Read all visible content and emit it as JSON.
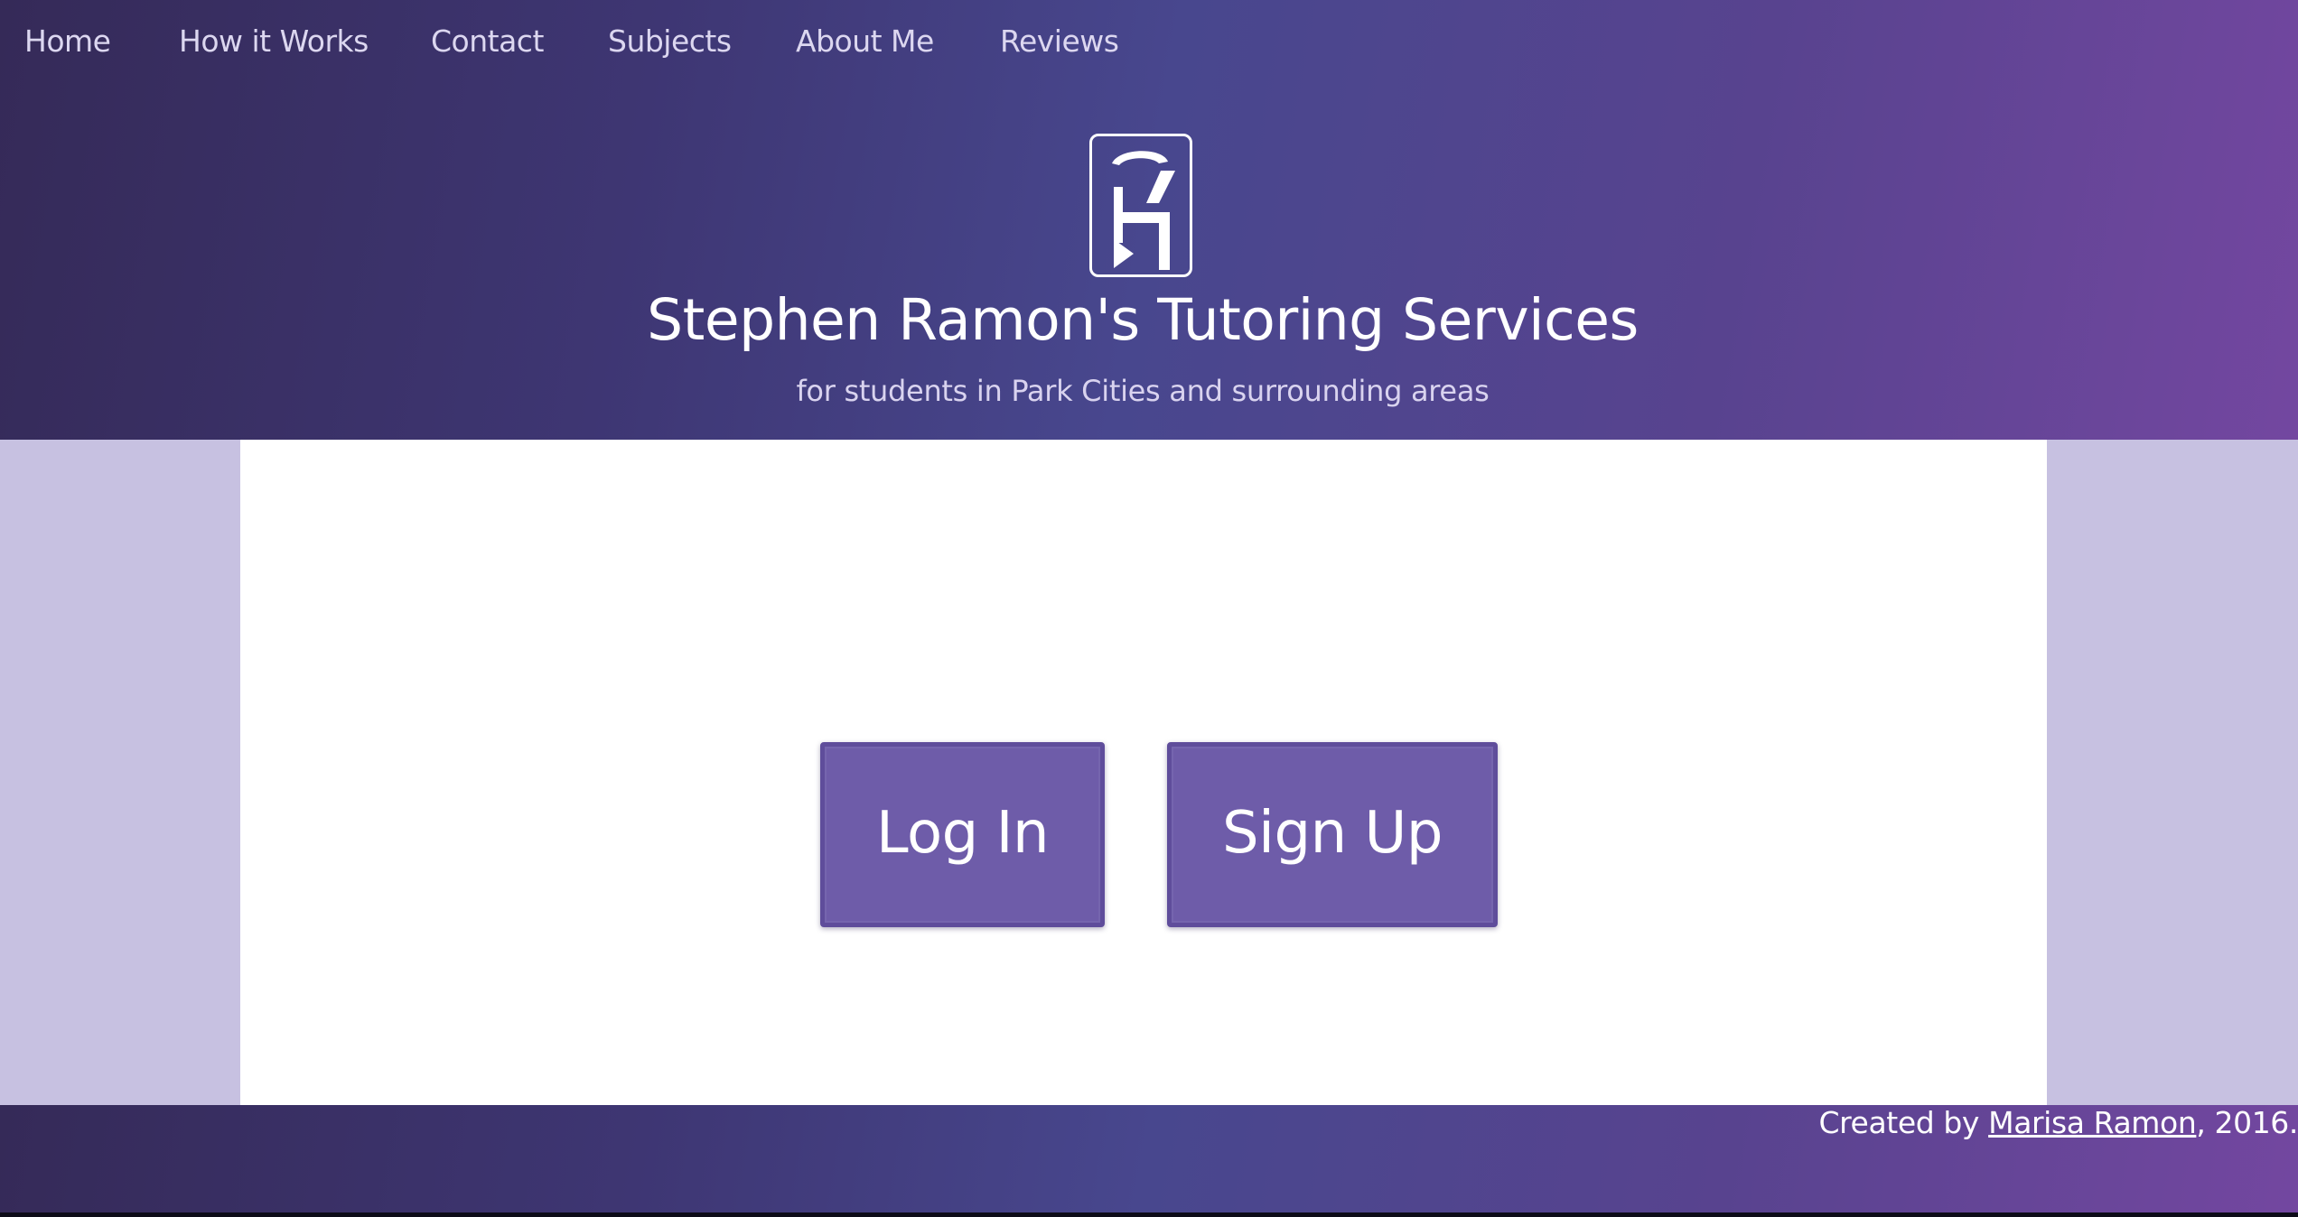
{
  "nav": {
    "items": [
      {
        "label": "Home"
      },
      {
        "label": "How it Works"
      },
      {
        "label": "Contact"
      },
      {
        "label": "Subjects"
      },
      {
        "label": "About Me"
      },
      {
        "label": "Reviews"
      }
    ]
  },
  "header": {
    "logo_icon": "sr-monogram-logo",
    "title": "Stephen Ramon's Tutoring Services",
    "subtitle": "for students in Park Cities and surrounding areas"
  },
  "main": {
    "login_label": "Log In",
    "signup_label": "Sign Up"
  },
  "footer": {
    "prefix": "Created by ",
    "author_link": "Marisa Ramon",
    "suffix": ", 2016."
  },
  "colors": {
    "header_gradient_start": "#352a58",
    "header_gradient_mid": "#48478e",
    "header_gradient_end": "#7347a0",
    "side_band": "#c7c1e1",
    "button_fill": "#6e5ca9",
    "button_border": "#5f4d9b"
  }
}
